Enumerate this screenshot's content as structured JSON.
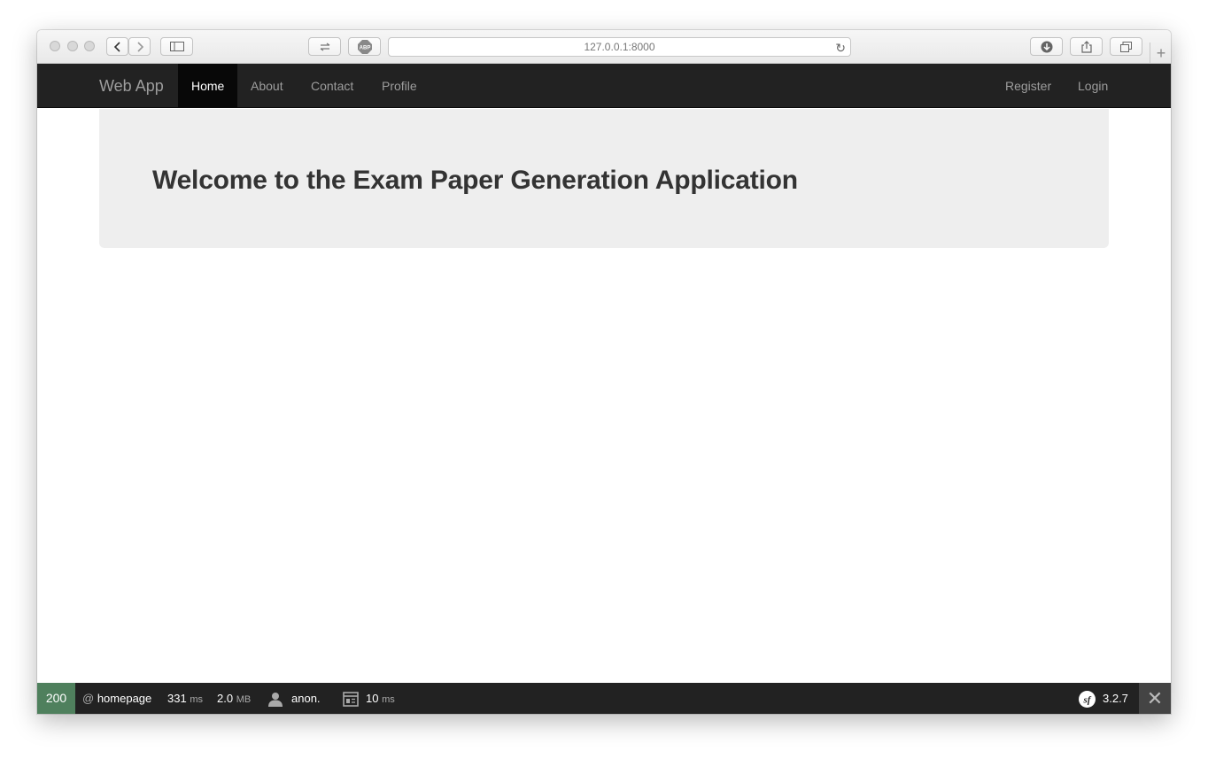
{
  "browser": {
    "url": "127.0.0.1:8000"
  },
  "navbar": {
    "brand": "Web App",
    "left_items": [
      {
        "label": "Home",
        "active": true
      },
      {
        "label": "About",
        "active": false
      },
      {
        "label": "Contact",
        "active": false
      },
      {
        "label": "Profile",
        "active": false
      }
    ],
    "right_items": [
      {
        "label": "Register"
      },
      {
        "label": "Login"
      }
    ]
  },
  "jumbotron": {
    "heading": "Welcome to the Exam Paper Generation Application"
  },
  "debug_toolbar": {
    "status_code": "200",
    "route": "homepage",
    "time_value": "331",
    "time_unit": "ms",
    "memory_value": "2.0",
    "memory_unit": "MB",
    "user": "anon.",
    "db_time_value": "10",
    "db_time_unit": "ms",
    "version": "3.2.7",
    "status_color": "#4f805d"
  }
}
